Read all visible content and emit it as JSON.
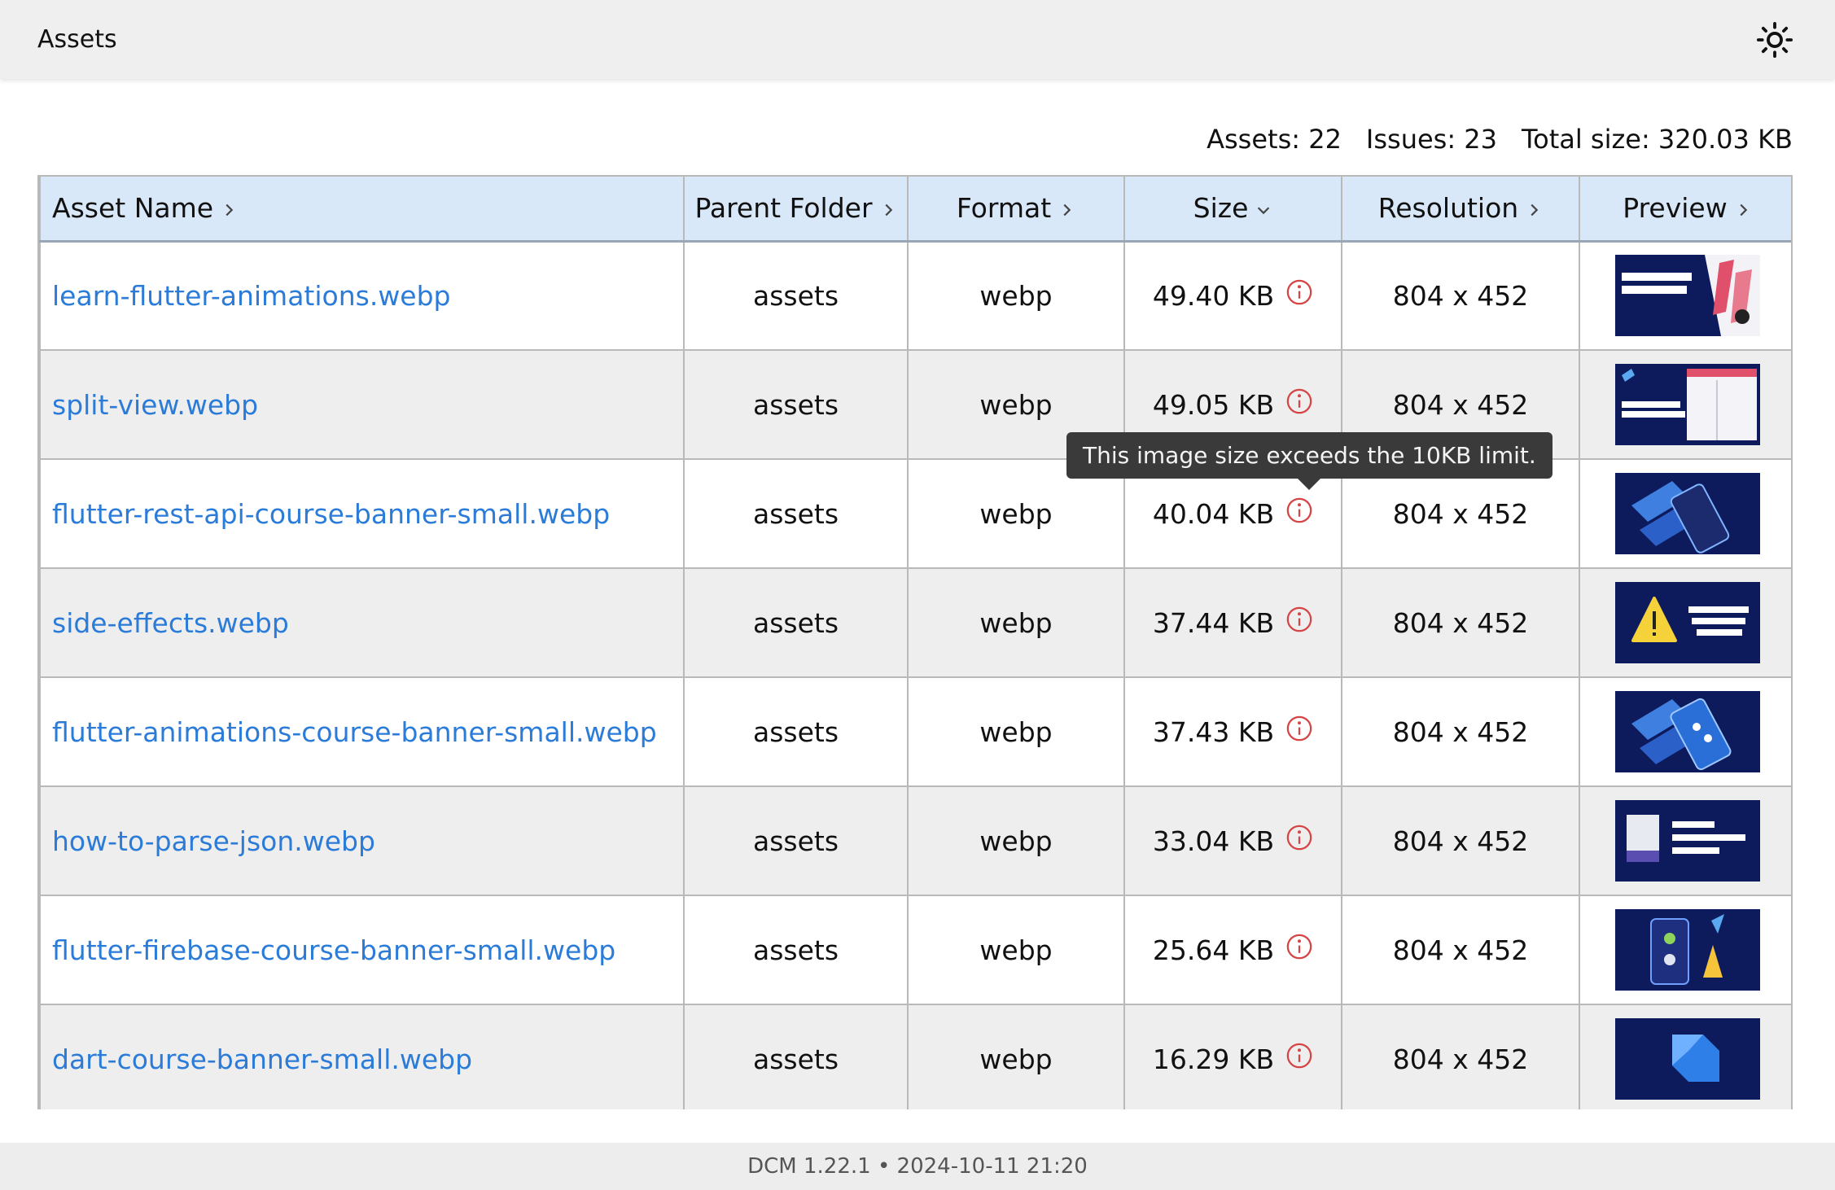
{
  "header": {
    "title": "Assets",
    "theme_icon": "sun-icon"
  },
  "summary": {
    "assets": "Assets: 22",
    "issues": "Issues: 23",
    "total_size": "Total size: 320.03 KB"
  },
  "table": {
    "columns": [
      {
        "label": "Asset Name",
        "sort_icon": "chevron-right-icon"
      },
      {
        "label": "Parent Folder",
        "sort_icon": "chevron-right-icon"
      },
      {
        "label": "Format",
        "sort_icon": "chevron-right-icon"
      },
      {
        "label": "Size",
        "sort_icon": "chevron-down-icon"
      },
      {
        "label": "Resolution",
        "sort_icon": "chevron-right-icon"
      },
      {
        "label": "Preview",
        "sort_icon": "chevron-right-icon"
      }
    ],
    "rows": [
      {
        "name": "learn-flutter-animations.webp",
        "folder": "assets",
        "format": "webp",
        "size": "49.40 KB",
        "resolution": "804 x 452"
      },
      {
        "name": "split-view.webp",
        "folder": "assets",
        "format": "webp",
        "size": "49.05 KB",
        "resolution": "804 x 452"
      },
      {
        "name": "flutter-rest-api-course-banner-small.webp",
        "folder": "assets",
        "format": "webp",
        "size": "40.04 KB",
        "resolution": "804 x 452"
      },
      {
        "name": "side-effects.webp",
        "folder": "assets",
        "format": "webp",
        "size": "37.44 KB",
        "resolution": "804 x 452"
      },
      {
        "name": "flutter-animations-course-banner-small.webp",
        "folder": "assets",
        "format": "webp",
        "size": "37.43 KB",
        "resolution": "804 x 452"
      },
      {
        "name": "how-to-parse-json.webp",
        "folder": "assets",
        "format": "webp",
        "size": "33.04 KB",
        "resolution": "804 x 452"
      },
      {
        "name": "flutter-firebase-course-banner-small.webp",
        "folder": "assets",
        "format": "webp",
        "size": "25.64 KB",
        "resolution": "804 x 452"
      },
      {
        "name": "dart-course-banner-small.webp",
        "folder": "assets",
        "format": "webp",
        "size": "16.29 KB",
        "resolution": "804 x 452"
      }
    ]
  },
  "tooltip": {
    "text": "This image size exceeds the 10KB limit."
  },
  "footer": {
    "text": "DCM 1.22.1 • 2024-10-11 21:20"
  },
  "colors": {
    "link": "#2b7bd8",
    "header_bg": "#d9e8f8",
    "warning_icon": "#d64545",
    "thumb_bg": "#0d1a5c",
    "tooltip_bg": "#3a3a3a"
  }
}
